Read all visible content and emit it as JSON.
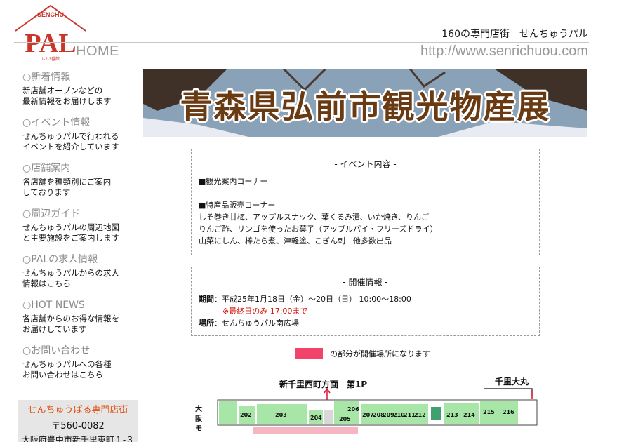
{
  "header": {
    "logo_arc": "SENCHU",
    "logo_text": "PAL",
    "logo_sub": "1-2-3番館",
    "home": "HOME",
    "tagline": "160の専門店街　せんちゅうパル",
    "url": "http://www.senrichuou.com"
  },
  "sidebar": {
    "items": [
      {
        "title": "○新着情報",
        "desc1": "新店舗オープンなどの",
        "desc2": "最新情報をお届けします"
      },
      {
        "title": "○イベント情報",
        "desc1": "せんちゅうパルで行われる",
        "desc2": "イベントを紹介しています"
      },
      {
        "title": "○店舗案内",
        "desc1": "各店舗を種類別にご案内",
        "desc2": "しております"
      },
      {
        "title": "○周辺ガイド",
        "desc1": "せんちゅうパルの周辺地図",
        "desc2": "と主要施設をご案内します"
      },
      {
        "title": "○PALの求人情報",
        "desc1": "せんちゅうパルからの求人",
        "desc2": "情報はこちら"
      },
      {
        "title": "○HOT NEWS",
        "desc1": "各店舗からのお得な情報を",
        "desc2": "お届けしています"
      },
      {
        "title": "○お問い合わせ",
        "desc1": "せんちゅうパルへの各種",
        "desc2": "お問い合わせはこちら"
      }
    ],
    "address": {
      "title": "せんちゅうぱる専門店街",
      "zip": "〒560-0082",
      "line": "大阪府豊中市新千里東町１-３"
    }
  },
  "banner": {
    "title": "青森県弘前市観光物産展"
  },
  "event_box": {
    "title": "- イベント内容 -",
    "line1": "■観光案内コーナー",
    "line2": "■特産品販売コーナー",
    "line3": "しそ巻き甘梅、アップルスナック、葉くるみ漬、いか焼き、りんご",
    "line4": "りんご酢、リンゴを使ったお菓子（アップルパイ・フリーズドライ）",
    "line5": "山菜にしん、棒たら煮、津軽塗、こぎん刺　他多数出品"
  },
  "info_box": {
    "title": "- 開催情報 -",
    "period_label": "期間",
    "period": "：平成25年1月18日（金）～20日（日） 10:00～18:00",
    "note": "※最終日のみ 17:00まで",
    "place_label": "場所",
    "place": "：せんちゅうパル南広場"
  },
  "legend": {
    "text": "の部分が開催場所になります",
    "color": "#f2436a"
  },
  "map": {
    "top_label": "新千里西町方面　第1P",
    "right_label": "千里大丸",
    "left_label1": "大",
    "left_label2": "阪",
    "left_label3": "モ",
    "shops": [
      "202",
      "203",
      "204",
      "205",
      "206",
      "207",
      "208",
      "209",
      "210",
      "211",
      "212",
      "213",
      "214",
      "215",
      "216"
    ],
    "colors": {
      "shop": "#a8e6a8",
      "venue": "#f5b5c2",
      "corridor": "#d8d8d8"
    }
  }
}
